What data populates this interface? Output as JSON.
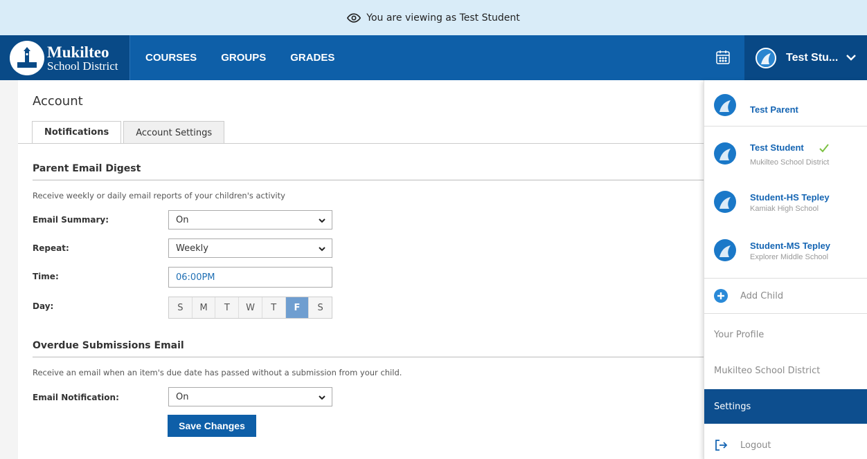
{
  "banner": {
    "text": "You are viewing as Test Student"
  },
  "logo": {
    "line1": "Mukilteo",
    "line2": "School District"
  },
  "nav": {
    "courses": "COURSES",
    "groups": "GROUPS",
    "grades": "GRADES"
  },
  "user_button": {
    "label": "Test Stu..."
  },
  "page": {
    "title": "Account",
    "tabs": [
      "Notifications",
      "Account Settings"
    ]
  },
  "digest": {
    "title": "Parent Email Digest",
    "description": "Receive weekly or daily email reports of your children's activity",
    "email_summary_label": "Email Summary:",
    "email_summary_value": "On",
    "repeat_label": "Repeat:",
    "repeat_value": "Weekly",
    "time_label": "Time:",
    "time_value": "06:00PM",
    "day_label": "Day:",
    "days": [
      "S",
      "M",
      "T",
      "W",
      "T",
      "F",
      "S"
    ],
    "selected_day_index": 5
  },
  "overdue": {
    "title": "Overdue Submissions Email",
    "description": "Receive an email when an item's due date has passed without a submission from your child.",
    "notification_label": "Email Notification:",
    "notification_value": "On"
  },
  "save_label": "Save Changes",
  "menu": {
    "users": [
      {
        "name": "Test Parent",
        "sub": ""
      },
      {
        "name": "Test Student",
        "sub": "Mukilteo School District",
        "current": true
      },
      {
        "name": "Student-HS Tepley",
        "sub": "Kamiak High School"
      },
      {
        "name": "Student-MS Tepley",
        "sub": "Explorer Middle School"
      }
    ],
    "add_child": "Add Child",
    "profile": "Your Profile",
    "district": "Mukilteo School District",
    "settings": "Settings",
    "logout": "Logout"
  },
  "colors": {
    "nav": "#0e5fa8",
    "nav_dark": "#084885",
    "banner": "#d9ecf8",
    "accent": "#1565b3",
    "check": "#7cc142"
  }
}
